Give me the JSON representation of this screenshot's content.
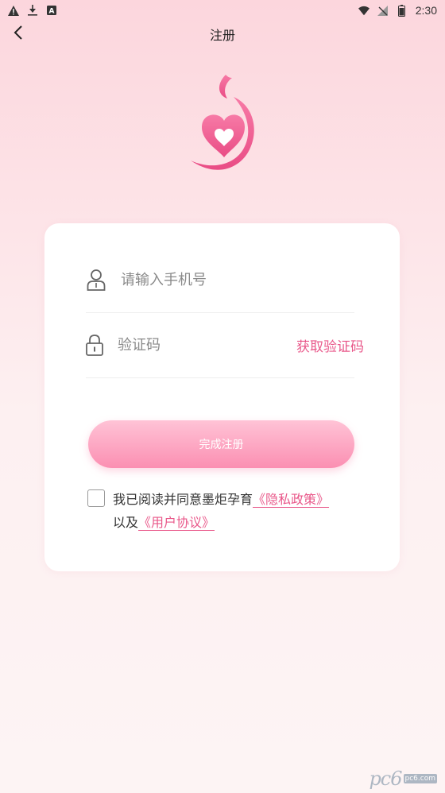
{
  "status_bar": {
    "time": "2:30",
    "left_icons": [
      "warning-icon",
      "download-icon",
      "a-icon"
    ],
    "right_icons": [
      "wifi-icon",
      "no-signal-icon",
      "battery-icon"
    ]
  },
  "nav": {
    "title": "注册",
    "back_icon": "chevron-left-icon"
  },
  "form": {
    "phone_placeholder": "请输入手机号",
    "phone_value": "",
    "code_placeholder": "验证码",
    "code_value": "",
    "get_code_label": "获取验证码",
    "submit_label": "完成注册"
  },
  "agreement": {
    "checked": false,
    "prefix": "我已阅读并同意墨炬孕育",
    "privacy_link": "《隐私政策》",
    "connector": "以及",
    "user_link": "《用户协议》"
  },
  "watermark": {
    "logo": "pc6",
    "domain": "pc6.com"
  },
  "colors": {
    "accent": "#e9588a",
    "button_top": "#ffc3d6",
    "button_bottom": "#fb8fb2",
    "background_top": "#fcd6dd",
    "background_bottom": "#fdf4f4"
  }
}
